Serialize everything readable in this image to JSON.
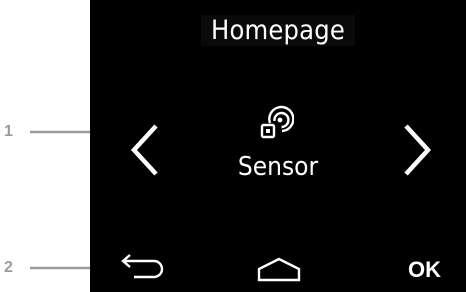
{
  "callouts": [
    {
      "number": "1"
    },
    {
      "number": "2"
    }
  ],
  "screen": {
    "title": "Homepage",
    "item": {
      "label": "Sensor",
      "icon": "sensor-icon"
    },
    "nav": {
      "prev_icon": "chevron-left-icon",
      "next_icon": "chevron-right-icon"
    },
    "softkeys": {
      "back_icon": "back-arrow-icon",
      "home_icon": "home-icon",
      "ok_label": "OK"
    }
  },
  "colors": {
    "screen_bg": "#000000",
    "text": "#ffffff",
    "callout": "#9a9a9a"
  }
}
